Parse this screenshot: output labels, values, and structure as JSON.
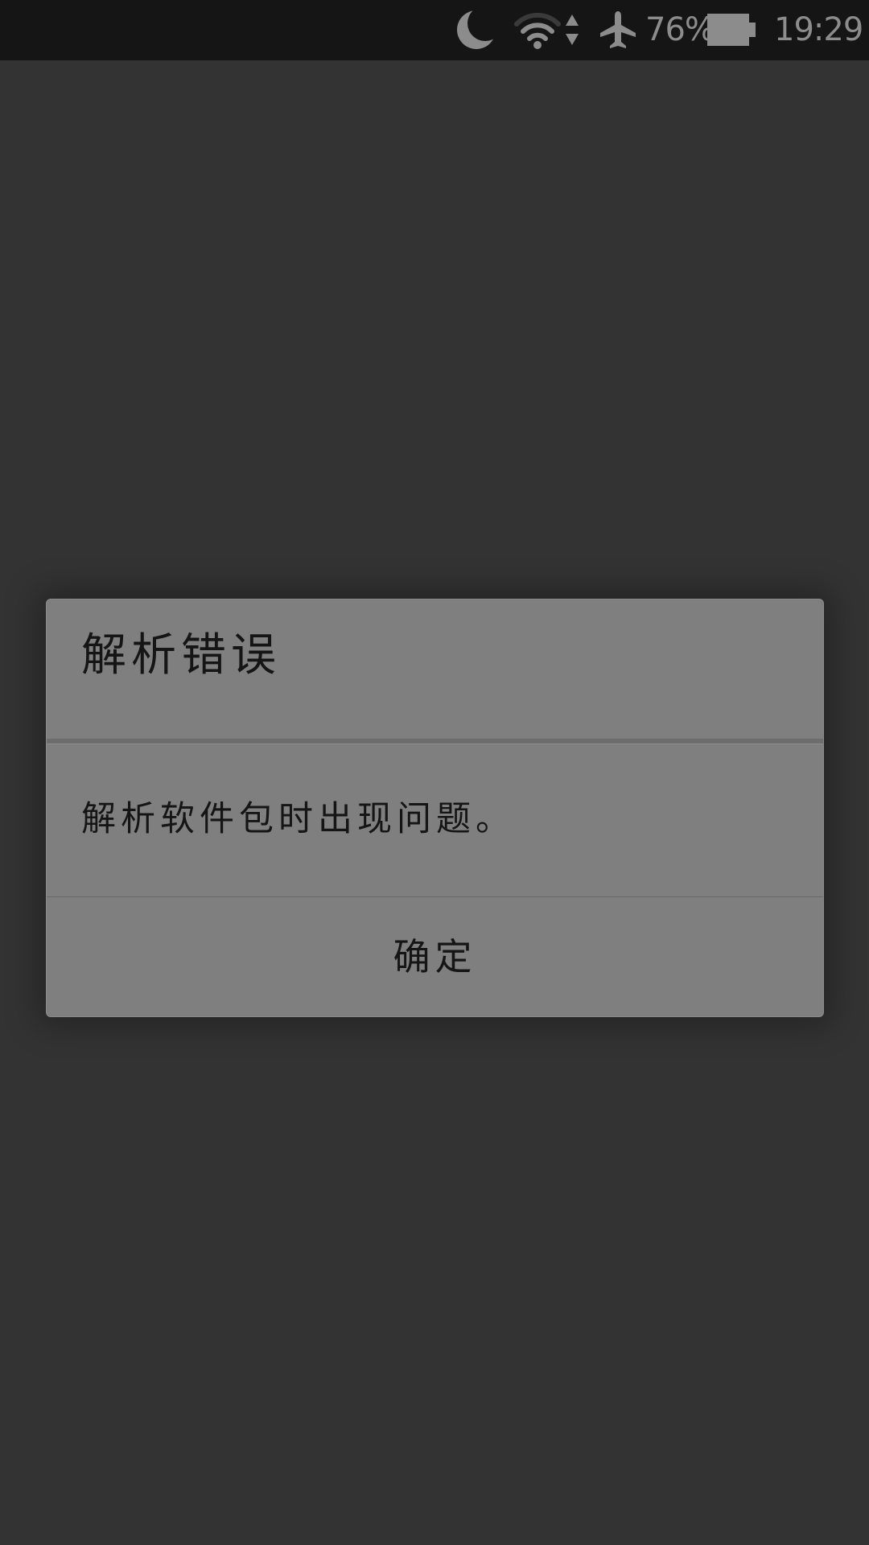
{
  "status_bar": {
    "icons": {
      "do_not_disturb": "moon-icon",
      "wifi": "wifi-icon",
      "data_activity": "data-arrows-icon",
      "airplane": "airplane-icon",
      "battery": "battery-icon"
    },
    "battery_percent": "76%",
    "time": "19:29",
    "icon_color": "#8c8c8c"
  },
  "dialog": {
    "title": "解析错误",
    "message": "解析软件包时出现问题。",
    "ok_label": "确定",
    "background": "#7f7f7f"
  },
  "screen": {
    "background": "#333333"
  }
}
